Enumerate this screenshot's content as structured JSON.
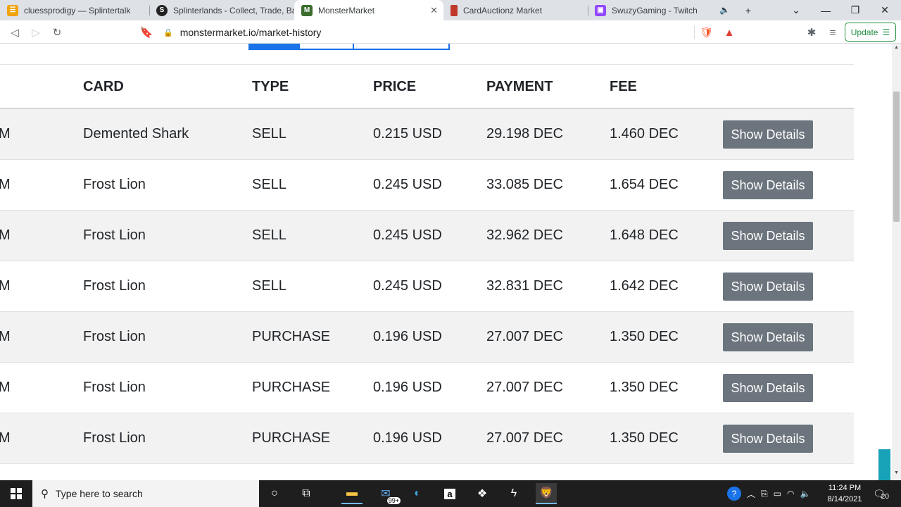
{
  "browser": {
    "tabs": [
      {
        "title": "cluessprodigy — Splintertalk",
        "favicon_color": "#f0a30a"
      },
      {
        "title": "Splinterlands - Collect, Trade, Battle",
        "favicon_color": "#222222"
      },
      {
        "title": "MonsterMarket",
        "favicon_color": "#3b6e2e",
        "active": true
      },
      {
        "title": "CardAuctionz Market",
        "favicon_color": "#c0392b"
      },
      {
        "title": "SwuzyGaming - Twitch",
        "favicon_color": "#9146ff"
      }
    ],
    "url": "monstermarket.io/market-history",
    "update_label": "Update"
  },
  "table": {
    "headers": {
      "card": "CARD",
      "type": "TYPE",
      "price": "PRICE",
      "payment": "PAYMENT",
      "fee": "FEE"
    },
    "button_label": "Show Details",
    "rows": [
      {
        "time_suffix": "M",
        "card": "Demented Shark",
        "type": "SELL",
        "price": "0.215 USD",
        "payment": "29.198 DEC",
        "fee": "1.460 DEC"
      },
      {
        "time_suffix": "M",
        "card": "Frost Lion",
        "type": "SELL",
        "price": "0.245 USD",
        "payment": "33.085 DEC",
        "fee": "1.654 DEC"
      },
      {
        "time_suffix": "M",
        "card": "Frost Lion",
        "type": "SELL",
        "price": "0.245 USD",
        "payment": "32.962 DEC",
        "fee": "1.648 DEC"
      },
      {
        "time_suffix": "M",
        "card": "Frost Lion",
        "type": "SELL",
        "price": "0.245 USD",
        "payment": "32.831 DEC",
        "fee": "1.642 DEC"
      },
      {
        "time_suffix": "M",
        "card": "Frost Lion",
        "type": "PURCHASE",
        "price": "0.196 USD",
        "payment": "27.007 DEC",
        "fee": "1.350 DEC"
      },
      {
        "time_suffix": "M",
        "card": "Frost Lion",
        "type": "PURCHASE",
        "price": "0.196 USD",
        "payment": "27.007 DEC",
        "fee": "1.350 DEC"
      },
      {
        "time_suffix": "M",
        "card": "Frost Lion",
        "type": "PURCHASE",
        "price": "0.196 USD",
        "payment": "27.007 DEC",
        "fee": "1.350 DEC"
      }
    ]
  },
  "taskbar": {
    "search_placeholder": "Type here to search",
    "mail_badge": "99+",
    "time": "11:24 PM",
    "date": "8/14/2021",
    "notification_count": "20"
  }
}
